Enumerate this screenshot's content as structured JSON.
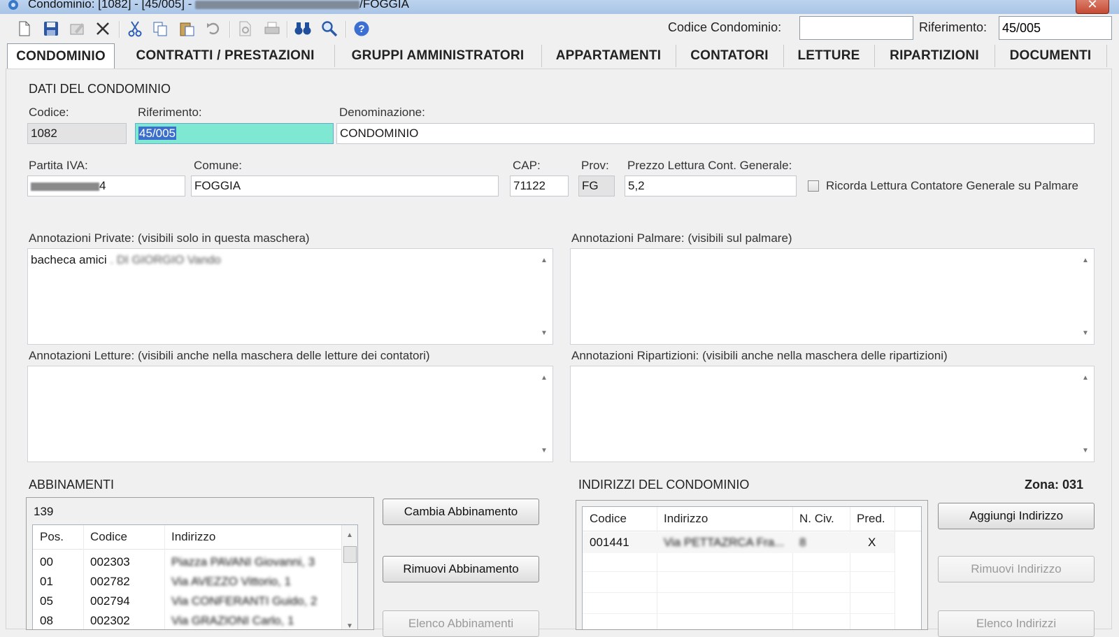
{
  "window": {
    "title_prefix": "Condominio: [1082] - [45/005] -",
    "title_suffix": "/FOGGIA",
    "close_label": "✕"
  },
  "toolbar": {
    "icons": [
      "new-file-icon",
      "save-icon",
      "edit-icon",
      "delete-icon",
      "cut-icon",
      "copy-icon",
      "paste-icon",
      "undo-icon",
      "print-preview-icon",
      "print-icon",
      "binoculars-icon",
      "search-icon",
      "help-icon"
    ],
    "codice_label": "Codice Condominio:",
    "codice_value": "",
    "riferimento_label": "Riferimento:",
    "riferimento_value": "45/005"
  },
  "tabs": [
    "CONDOMINIO",
    "CONTRATTI / PRESTAZIONI",
    "GRUPPI AMMINISTRATORI",
    "APPARTAMENTI",
    "CONTATORI",
    "LETTURE",
    "RIPARTIZIONI",
    "DOCUMENTI"
  ],
  "dati": {
    "section_title": "DATI DEL CONDOMINIO",
    "codice_label": "Codice:",
    "codice_value": "1082",
    "riferimento_label": "Riferimento:",
    "riferimento_value": "45/005",
    "denominazione_label": "Denominazione:",
    "denominazione_value": "CONDOMINIO",
    "piva_label": "Partita IVA:",
    "piva_value_visible": "4",
    "comune_label": "Comune:",
    "comune_value": "FOGGIA",
    "cap_label": "CAP:",
    "cap_value": "71122",
    "prov_label": "Prov:",
    "prov_value": "FG",
    "prezzo_label": "Prezzo Lettura Cont. Generale:",
    "prezzo_value": "5,2",
    "ricorda_label": "Ricorda Lettura Contatore Generale su Palmare"
  },
  "notes": {
    "private_label": "Annotazioni Private: (visibili solo in questa maschera)",
    "private_value": "bacheca amici",
    "palmare_label": "Annotazioni Palmare: (visibili sul palmare)",
    "letture_label": "Annotazioni Letture: (visibili anche nella maschera delle letture dei contatori)",
    "ripartizioni_label": "Annotazioni Ripartizioni: (visibili anche nella maschera delle ripartizioni)"
  },
  "abbinamenti": {
    "section_title": "ABBINAMENTI",
    "group_number": "139",
    "headers": [
      "Pos.",
      "Codice",
      "Indirizzo"
    ],
    "rows": [
      {
        "pos": "00",
        "codice": "002303"
      },
      {
        "pos": "01",
        "codice": "002782"
      },
      {
        "pos": "05",
        "codice": "002794"
      },
      {
        "pos": "08",
        "codice": "002302"
      }
    ],
    "cambia_label": "Cambia Abbinamento",
    "rimuovi_label": "Rimuovi Abbinamento",
    "elenco_label": "Elenco Abbinamenti"
  },
  "indirizzi": {
    "section_title": "INDIRIZZI DEL CONDOMINIO",
    "zona_label": "Zona: 031",
    "headers": [
      "Codice",
      "Indirizzo",
      "N. Civ.",
      "Pred."
    ],
    "rows": [
      {
        "codice": "001441",
        "civ": "8",
        "pred": "X"
      }
    ],
    "aggiungi_label": "Aggiungi Indirizzo",
    "rimuovi_label": "Rimuovi Indirizzo",
    "elenco_label": "Elenco Indirizzi"
  }
}
